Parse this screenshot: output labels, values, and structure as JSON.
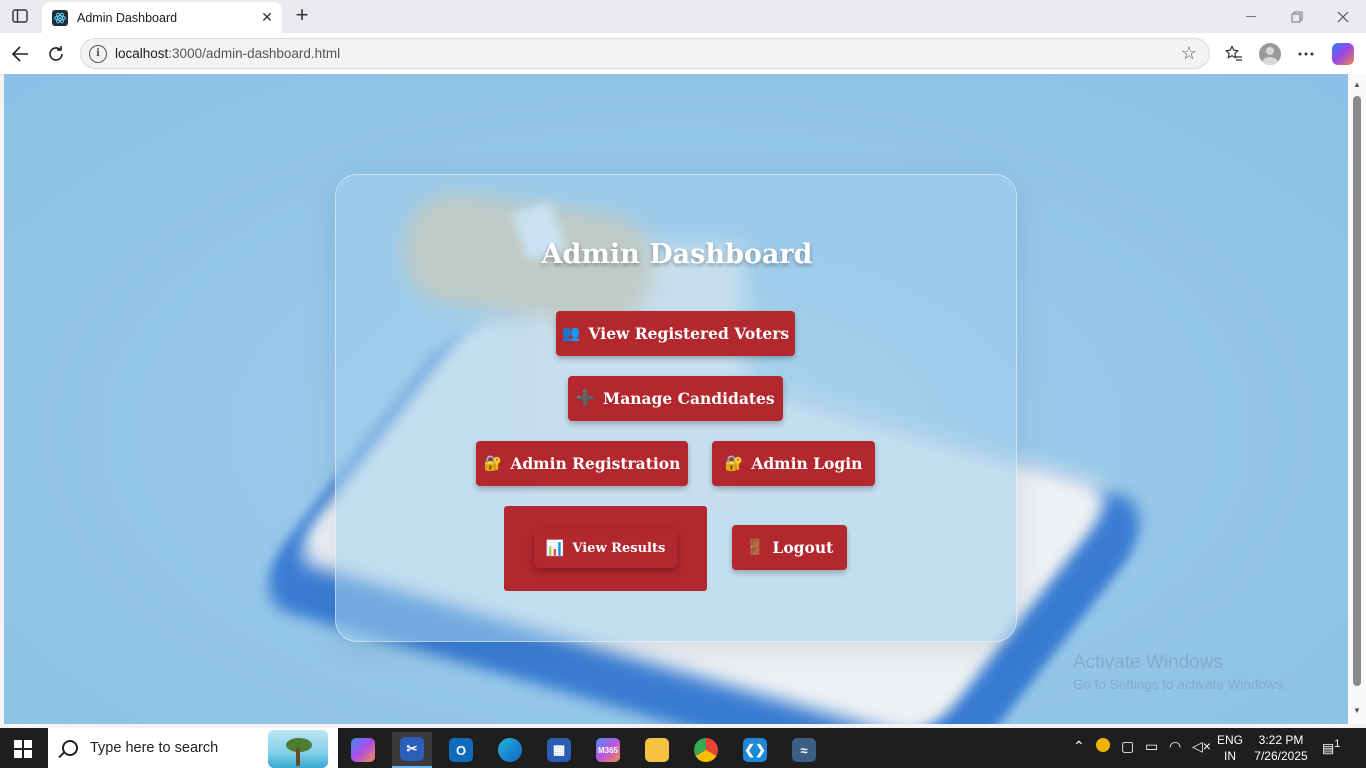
{
  "browser": {
    "tab_title": "Admin Dashboard",
    "url_host": "localhost",
    "url_path": ":3000/admin-dashboard.html",
    "new_tab_symbol": "+",
    "close_symbol": "✕"
  },
  "page": {
    "title": "Admin Dashboard",
    "buttons": {
      "view_voters": "View Registered Voters",
      "manage_candidates": "Manage Candidates",
      "admin_registration": "Admin Registration",
      "admin_login": "Admin Login",
      "view_results": "View Results",
      "logout": "Logout"
    },
    "icons": {
      "view_voters": "👥",
      "manage_candidates": "➕",
      "admin_registration": "🔐",
      "admin_login": "🔐",
      "view_results": "📊",
      "logout": "🚪"
    }
  },
  "watermark": {
    "line1": "Activate Windows",
    "line2": "Go to Settings to activate Windows."
  },
  "taskbar": {
    "search_placeholder": "Type here to search",
    "language": "ENG",
    "region": "IN",
    "time": "3:22 PM",
    "date": "7/26/2025",
    "notification_count": "1",
    "apps": [
      "copilot-app",
      "snipping-tool",
      "outlook",
      "edge",
      "microsoft-store",
      "m365",
      "file-explorer",
      "chrome",
      "vs-code",
      "mysql-workbench"
    ]
  },
  "colors": {
    "button_bg": "#b2282e",
    "page_bg": "#8cc0e6",
    "title_text": "#ffffff"
  }
}
